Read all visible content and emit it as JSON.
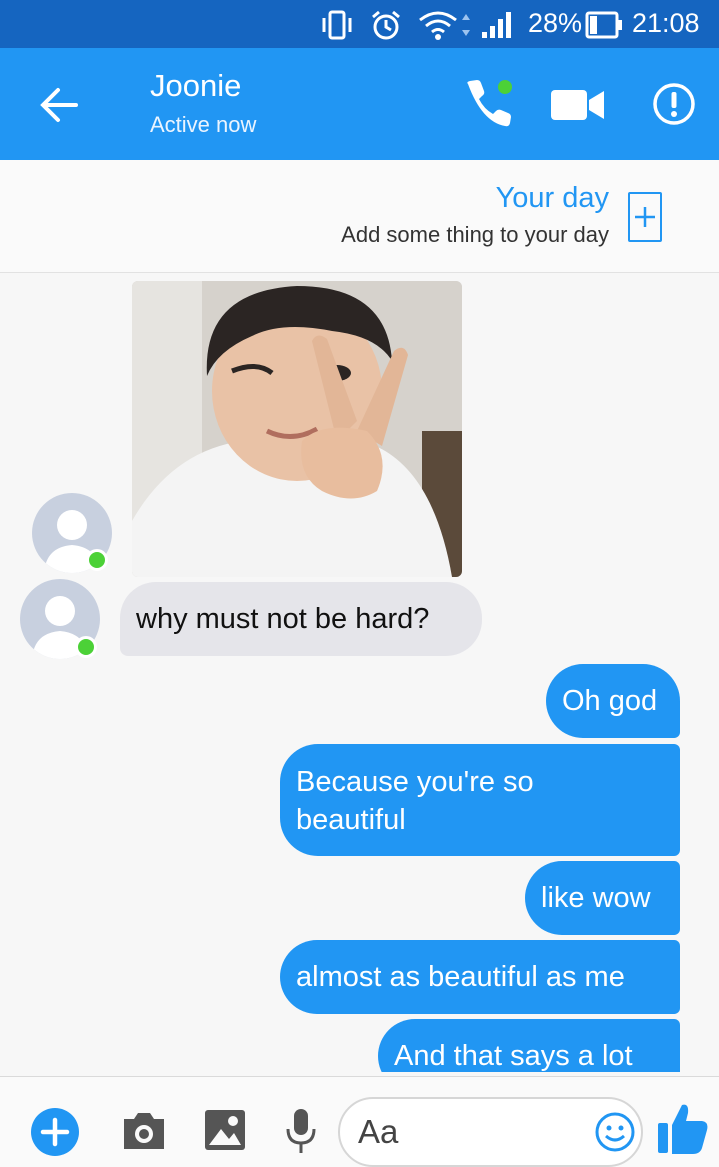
{
  "status_bar": {
    "battery_percent": "28%",
    "time": "21:08",
    "icons": [
      "vibrate-icon",
      "alarm-icon",
      "wifi-icon",
      "signal-icon",
      "battery-icon"
    ]
  },
  "header": {
    "contact_name": "Joonie",
    "contact_status": "Active now",
    "buttons": [
      "back-arrow-icon",
      "phone-call-icon",
      "video-call-icon",
      "info-icon"
    ]
  },
  "your_day": {
    "title": "Your day",
    "subtitle": "Add some thing to your day"
  },
  "messages": {
    "incoming": [
      {
        "type": "photo"
      },
      {
        "type": "text",
        "text": "why must not be hard?"
      }
    ],
    "outgoing": [
      {
        "text": "Oh god"
      },
      {
        "text": "Because you're so beautiful"
      },
      {
        "text": "like wow"
      },
      {
        "text": "almost as beautiful as me"
      },
      {
        "text": "And that says a lot"
      }
    ]
  },
  "composer": {
    "placeholder": "Aa",
    "buttons": [
      "plus-icon",
      "camera-icon",
      "gallery-icon",
      "microphone-icon",
      "emoji-icon",
      "thumbs-up-icon"
    ]
  },
  "colors": {
    "status_bar": "#1565c0",
    "header": "#2196f3",
    "outgoing_bubble": "#2196f3",
    "incoming_bubble": "#e5e5ea",
    "online": "#4cd137"
  }
}
